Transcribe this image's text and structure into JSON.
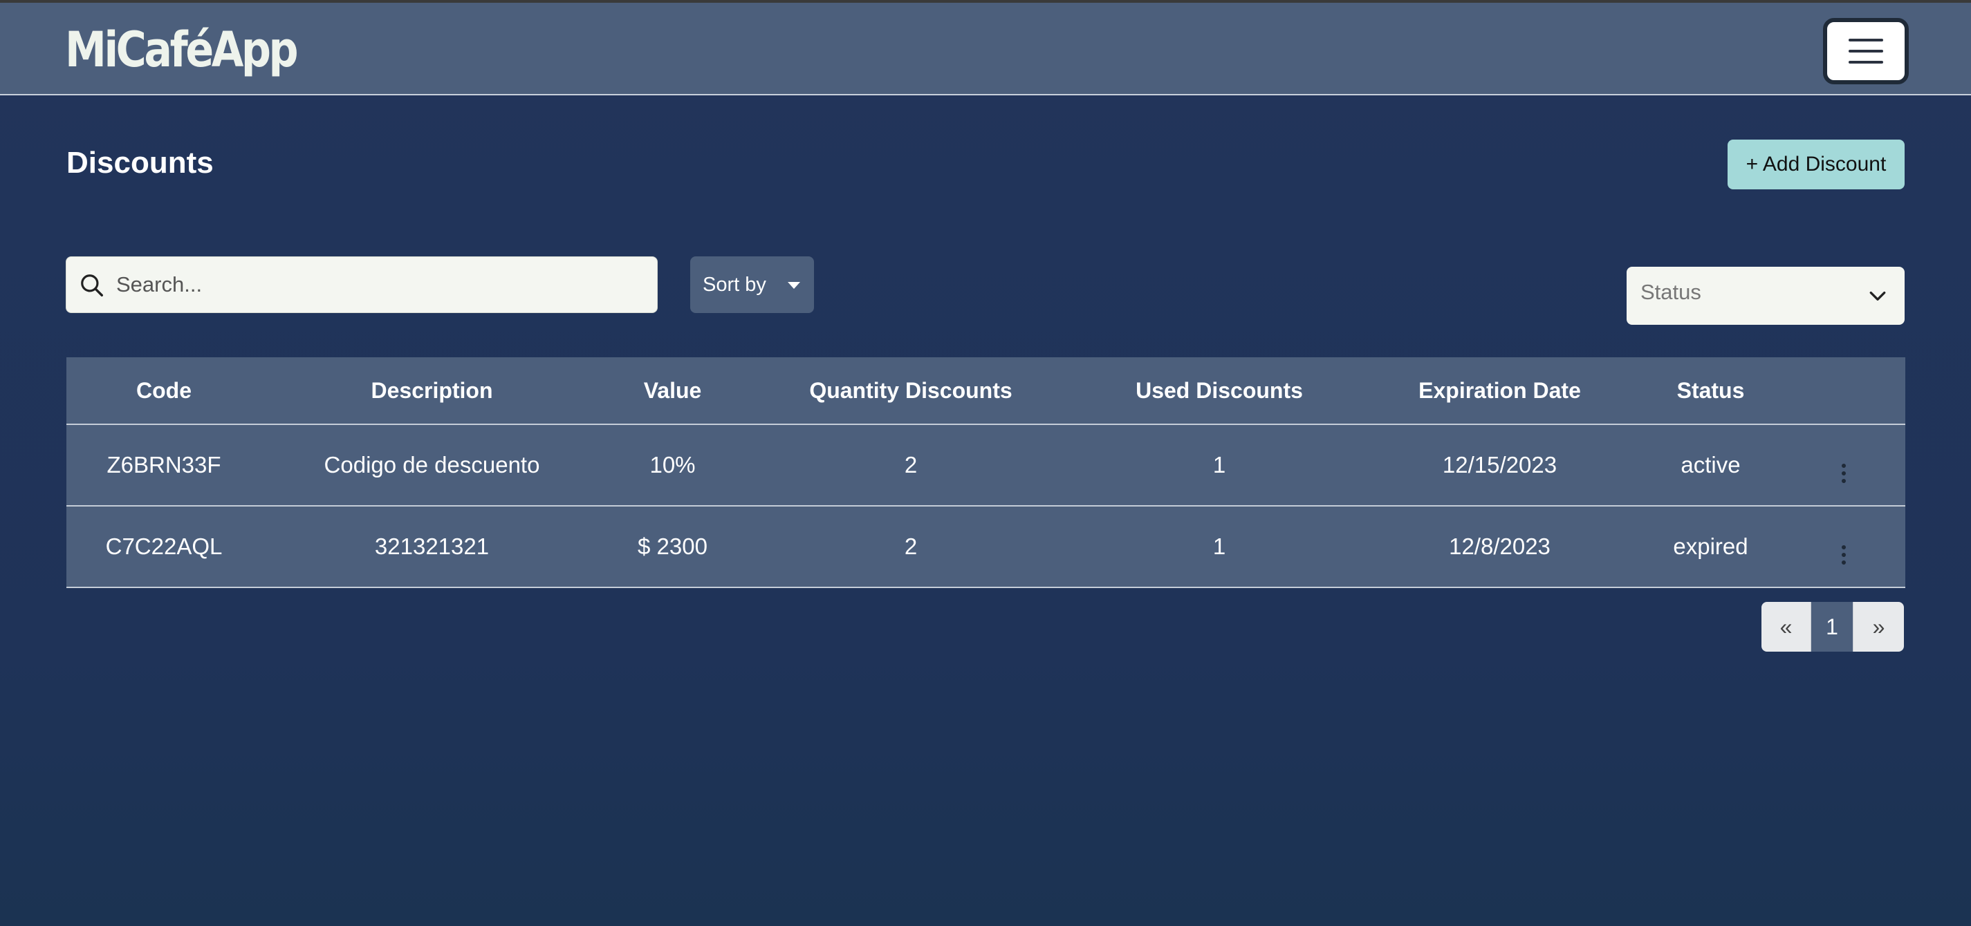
{
  "navbar": {
    "brand": "MiCaféApp",
    "menu_icon": "hamburger-menu-icon"
  },
  "page": {
    "title": "Discounts",
    "add_label": "+ Add Discount"
  },
  "toolbar": {
    "search_placeholder": "Search...",
    "search_icon": "search-icon",
    "sort_label": "Sort by",
    "status_selected": "Status"
  },
  "table": {
    "headers": [
      "Code",
      "Description",
      "Value",
      "Quantity Discounts",
      "Used Discounts",
      "Expiration Date",
      "Status"
    ],
    "rows": [
      {
        "code": "Z6BRN33F",
        "description": "Codigo de descuento",
        "value": "10%",
        "quantity": "2",
        "used": "1",
        "expiration": "12/15/2023",
        "status": "active"
      },
      {
        "code": "C7C22AQL",
        "description": "321321321",
        "value": "$ 2300",
        "quantity": "2",
        "used": "1",
        "expiration": "12/8/2023",
        "status": "expired"
      }
    ]
  },
  "pagination": {
    "prev": "«",
    "current": "1",
    "next": "»"
  },
  "colors": {
    "background": "#22345b",
    "navbar": "#4c5f7c",
    "accent_button": "#a3d9d9"
  }
}
